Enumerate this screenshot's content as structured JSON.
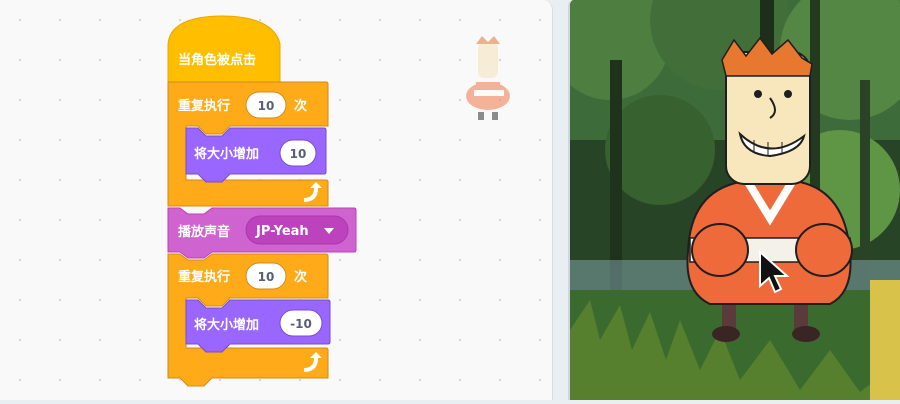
{
  "scripts": {
    "hat": {
      "label": "当角色被点击"
    },
    "repeat_1": {
      "label": "重复执行",
      "count": "10",
      "suffix": "次"
    },
    "change_size_1": {
      "label": "将大小增加",
      "value": "10"
    },
    "play_sound": {
      "label": "播放声音",
      "sound": "JP-Yeah"
    },
    "repeat_2": {
      "label": "重复执行",
      "count": "10",
      "suffix": "次"
    },
    "change_size_2": {
      "label": "将大小增加",
      "value": "-10"
    }
  },
  "colors": {
    "control": "#ffab19",
    "control_dark": "#cf8b17",
    "looks": "#9966ff",
    "looks_dark": "#774dcb",
    "sound": "#cf63cf",
    "sound_dark": "#bd42bd"
  },
  "icons": {
    "loop_arrow": "loop-arrow-icon",
    "dropdown": "dropdown-arrow-icon",
    "cursor": "mouse-cursor-icon"
  }
}
